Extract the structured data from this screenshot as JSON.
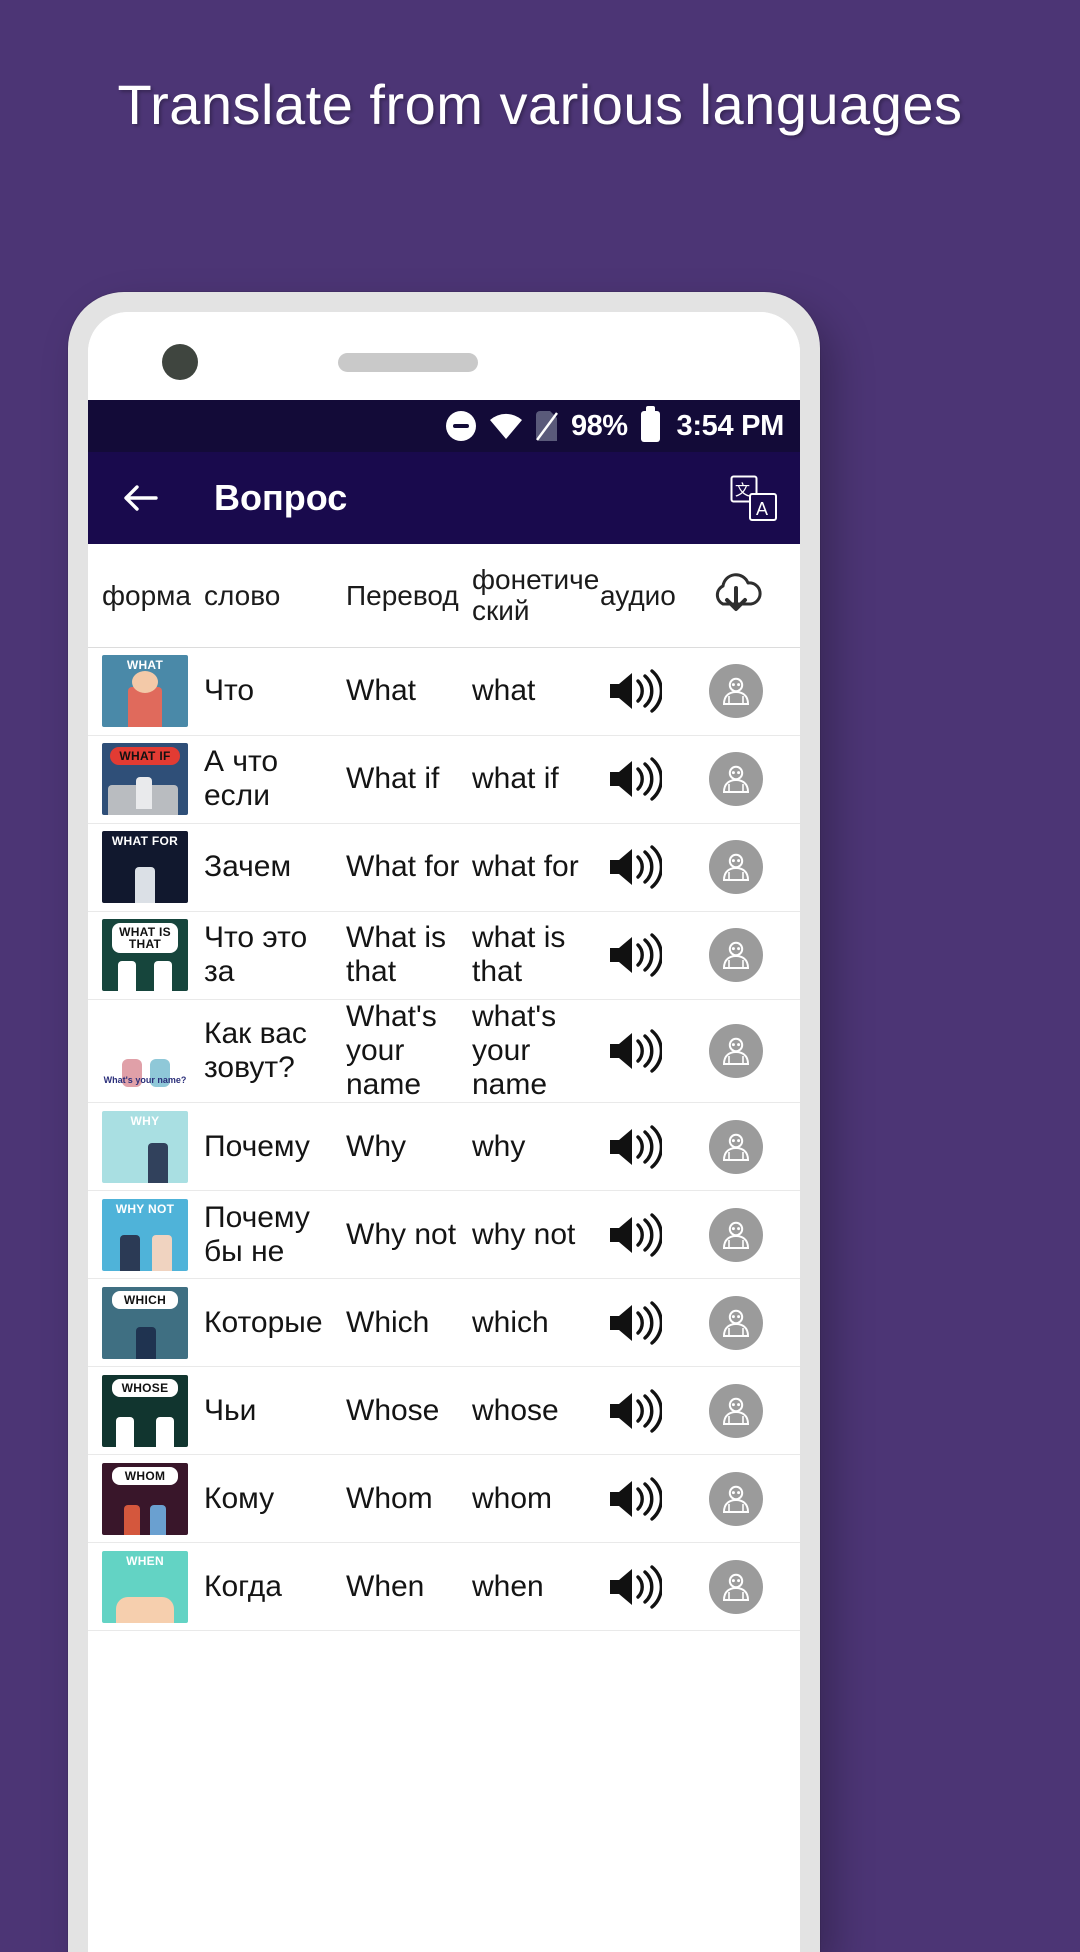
{
  "promo": {
    "headline": "Translate from various languages"
  },
  "status_bar": {
    "dnd_icon": "do-not-disturb-icon",
    "wifi_icon": "wifi-icon",
    "sim_icon": "no-sim-icon",
    "battery_percent": "98%",
    "battery_icon": "battery-icon",
    "time": "3:54 PM"
  },
  "app_bar": {
    "back_icon": "back-arrow-icon",
    "title": "Вопрос",
    "translate_icon": "translate-icon"
  },
  "table": {
    "headers": {
      "form": "форма",
      "word": "слово",
      "translation": "Перевод",
      "phonetic": "фонетиче ский",
      "audio": "аудио",
      "download_icon": "download-cloud-icon"
    },
    "rows": [
      {
        "thumb_label": "WHAT",
        "thumb_bg": "#4a89a8",
        "word": "Что",
        "translation": "What",
        "phonetic": "what",
        "audio_icon": "speaker-icon",
        "avatar_icon": "avatar-icon"
      },
      {
        "thumb_label": "WHAT IF",
        "thumb_bg": "#2f4f78",
        "word": "А что если",
        "translation": "What if",
        "phonetic": "what if",
        "audio_icon": "speaker-icon",
        "avatar_icon": "avatar-icon"
      },
      {
        "thumb_label": "WHAT FOR",
        "thumb_bg": "#11182e",
        "word": "Зачем",
        "translation": "What for",
        "phonetic": "what for",
        "audio_icon": "speaker-icon",
        "avatar_icon": "avatar-icon"
      },
      {
        "thumb_label": "WHAT IS THAT",
        "thumb_bg": "#16453c",
        "word": "Что это за",
        "translation": "What is that",
        "phonetic": "what is that",
        "audio_icon": "speaker-icon",
        "avatar_icon": "avatar-icon"
      },
      {
        "thumb_label": "",
        "thumb_foot": "What's your name?",
        "thumb_bg": "#ffffff",
        "word": "Как вас зовут?",
        "translation": "What's your name",
        "phonetic": "what's your name",
        "audio_icon": "speaker-icon",
        "avatar_icon": "avatar-icon"
      },
      {
        "thumb_label": "WHY",
        "thumb_bg": "#a9dfe2",
        "word": "Почему",
        "translation": "Why",
        "phonetic": "why",
        "audio_icon": "speaker-icon",
        "avatar_icon": "avatar-icon"
      },
      {
        "thumb_label": "WHY NOT",
        "thumb_bg": "#4fb3d9",
        "word": "Почему бы не",
        "translation": "Why not",
        "phonetic": "why not",
        "audio_icon": "speaker-icon",
        "avatar_icon": "avatar-icon"
      },
      {
        "thumb_label": "WHICH",
        "thumb_bg": "#3f6f82",
        "word": "Которые",
        "translation": "Which",
        "phonetic": "which",
        "audio_icon": "speaker-icon",
        "avatar_icon": "avatar-icon"
      },
      {
        "thumb_label": "WHOSE",
        "thumb_bg": "#11352f",
        "word": "Чьи",
        "translation": "Whose",
        "phonetic": "whose",
        "audio_icon": "speaker-icon",
        "avatar_icon": "avatar-icon"
      },
      {
        "thumb_label": "WHOM",
        "thumb_bg": "#39162a",
        "word": "Кому",
        "translation": "Whom",
        "phonetic": "whom",
        "audio_icon": "speaker-icon",
        "avatar_icon": "avatar-icon"
      },
      {
        "thumb_label": "WHEN",
        "thumb_bg": "#63d3c4",
        "word": "Когда",
        "translation": "When",
        "phonetic": "when",
        "audio_icon": "speaker-icon",
        "avatar_icon": "avatar-icon"
      }
    ]
  },
  "colors": {
    "page_background": "#4c3575",
    "app_bar": "#190a4d",
    "status_bar": "#130b38",
    "text_primary": "#141414"
  }
}
